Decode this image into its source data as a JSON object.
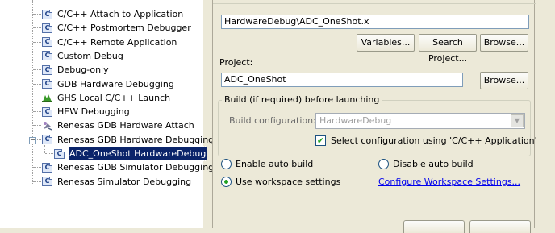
{
  "tree": {
    "items": [
      {
        "label": "C/C++ Attach to Application",
        "icon": "c-launch-icon"
      },
      {
        "label": "C/C++ Postmortem Debugger",
        "icon": "c-launch-icon"
      },
      {
        "label": "C/C++ Remote Application",
        "icon": "c-launch-icon"
      },
      {
        "label": "Custom Debug",
        "icon": "c-launch-icon"
      },
      {
        "label": "Debug-only",
        "icon": "c-launch-icon"
      },
      {
        "label": "GDB Hardware Debugging",
        "icon": "c-launch-icon"
      },
      {
        "label": "GHS Local C/C++ Launch",
        "icon": "ghs-launch-icon"
      },
      {
        "label": "HEW Debugging",
        "icon": "c-launch-icon"
      },
      {
        "label": "Renesas GDB Hardware Attach",
        "icon": "renesas-attach-icon"
      },
      {
        "label": "Renesas GDB Hardware Debugging",
        "icon": "c-launch-icon",
        "expanded": true
      },
      {
        "label": "ADC_OneShot HardwareDebug",
        "icon": "c-launch-icon",
        "selected": true,
        "child": true
      },
      {
        "label": "Renesas GDB Simulator Debugging",
        "icon": "c-launch-icon"
      },
      {
        "label": "Renesas Simulator Debugging",
        "icon": "c-launch-icon"
      }
    ],
    "icon_text": "C",
    "toggle": "−"
  },
  "main": {
    "application_value": "HardwareDebug\\ADC_OneShot.x",
    "variables_label": "Variables...",
    "search_project_label": "Search Project...",
    "browse_label": "Browse...",
    "project_label": "Project:",
    "project_value": "ADC_OneShot",
    "project_browse_label": "Browse...",
    "build_group_title": "Build (if required) before launching",
    "build_config_label": "Build configuration:",
    "build_config_value": "HardwareDebug",
    "select_config_label": "Select configuration using 'C/C++ Application'",
    "select_config_checked": true,
    "enable_auto_build": "Enable auto build",
    "disable_auto_build": "Disable auto build",
    "use_workspace_settings": "Use workspace settings",
    "configure_workspace_link": "Configure Workspace Settings...",
    "selected_build_option": "use_workspace_settings"
  },
  "colors": {
    "selection": "#0a246a",
    "window_bg": "#ece9d8",
    "link": "#0000ee"
  }
}
